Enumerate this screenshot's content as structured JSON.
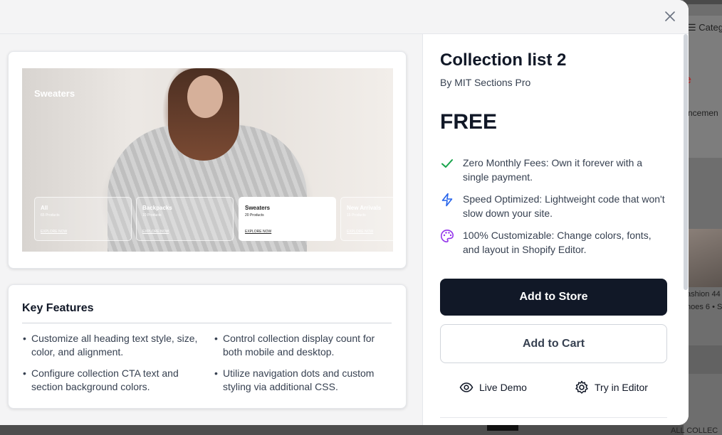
{
  "background": {
    "categories_label": "☰ Categ",
    "announcement_label": "ncemen",
    "fashion_label": "ashion 44",
    "shoes_label": "hoes 6 • S",
    "all_collections_label": "ALL COLLEC"
  },
  "preview": {
    "hero_title": "Sweaters",
    "cards": [
      {
        "title": "All",
        "count": "65 Products",
        "cta": "EXPLORE NOW"
      },
      {
        "title": "Backpacks",
        "count": "10 Products",
        "cta": "EXPLORE NOW"
      },
      {
        "title": "Sweaters",
        "count": "20 Products",
        "cta": "EXPLORE NOW"
      },
      {
        "title": "New Arrivals",
        "count": "15 Products",
        "cta": "EXPLORE NOW"
      }
    ]
  },
  "features": {
    "title": "Key Features",
    "items": [
      "Customize all heading text style, size, color, and alignment.",
      "Control collection display count for both mobile and desktop.",
      "Configure collection CTA text and section background colors.",
      "Utilize navigation dots and custom styling via additional CSS."
    ]
  },
  "product": {
    "title": "Collection list 2",
    "author": "By MIT Sections Pro",
    "price": "FREE"
  },
  "benefits": [
    {
      "icon": "check-icon",
      "color": "#16a34a",
      "text": "Zero Monthly Fees: Own it forever with a single payment."
    },
    {
      "icon": "lightning-icon",
      "color": "#2563eb",
      "text": "Speed Optimized: Lightweight code that won't slow down your site."
    },
    {
      "icon": "palette-icon",
      "color": "#9333ea",
      "text": "100% Customizable: Change colors, fonts, and layout in Shopify Editor."
    }
  ],
  "actions": {
    "add_to_store": "Add to Store",
    "add_to_cart": "Add to Cart",
    "live_demo": "Live Demo",
    "try_editor": "Try in Editor"
  },
  "colors": {
    "primary": "#111827",
    "panel_bg": "#f4f4f5"
  }
}
